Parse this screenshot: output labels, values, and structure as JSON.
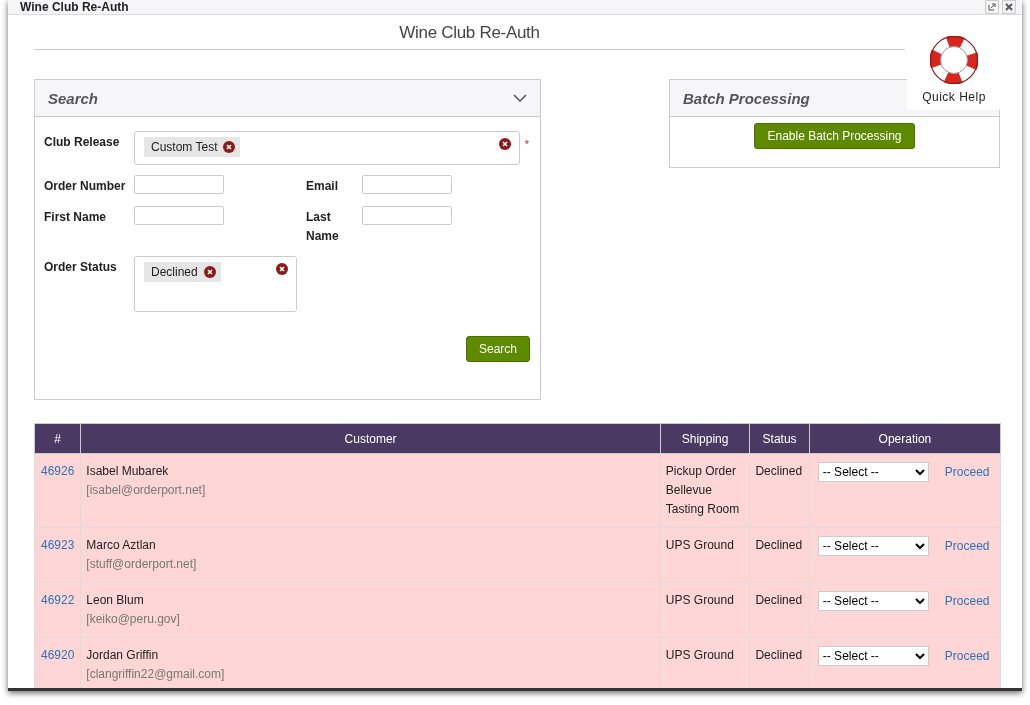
{
  "window": {
    "title": "Wine Club Re-Auth"
  },
  "page_title": "Wine Club Re-Auth",
  "quick_help": {
    "label": "Quick Help"
  },
  "search_panel": {
    "title": "Search",
    "club_release": {
      "label": "Club Release",
      "tags": [
        "Custom Test"
      ],
      "required_mark": "*"
    },
    "order_number": {
      "label": "Order Number"
    },
    "email": {
      "label": "Email"
    },
    "first_name": {
      "label": "First Name"
    },
    "last_name": {
      "label": "Last Name"
    },
    "order_status": {
      "label": "Order Status",
      "tags": [
        "Declined"
      ]
    },
    "button": "Search"
  },
  "batch_panel": {
    "title": "Batch Processing",
    "button": "Enable Batch Processing"
  },
  "table": {
    "columns": [
      "#",
      "Customer",
      "Shipping",
      "Status",
      "Operation"
    ],
    "rows": [
      {
        "order": "46926",
        "name": "Isabel Mubarek",
        "email": "[isabel@orderport.net]",
        "shipping": "Pickup Order Bellevue Tasting Room",
        "status": "Declined",
        "operation": "-- Select --",
        "action": "Proceed"
      },
      {
        "order": "46923",
        "name": "Marco Aztlan",
        "email": "[stuff@orderport.net]",
        "shipping": "UPS Ground",
        "status": "Declined",
        "operation": "-- Select --",
        "action": "Proceed"
      },
      {
        "order": "46922",
        "name": "Leon Blum",
        "email": "[keiko@peru.gov]",
        "shipping": "UPS Ground",
        "status": "Declined",
        "operation": "-- Select --",
        "action": "Proceed"
      },
      {
        "order": "46920",
        "name": "Jordan Griffin",
        "email": "[clangriffin22@gmail.com]",
        "shipping": "UPS Ground",
        "status": "Declined",
        "operation": "-- Select --",
        "action": "Proceed"
      }
    ]
  }
}
